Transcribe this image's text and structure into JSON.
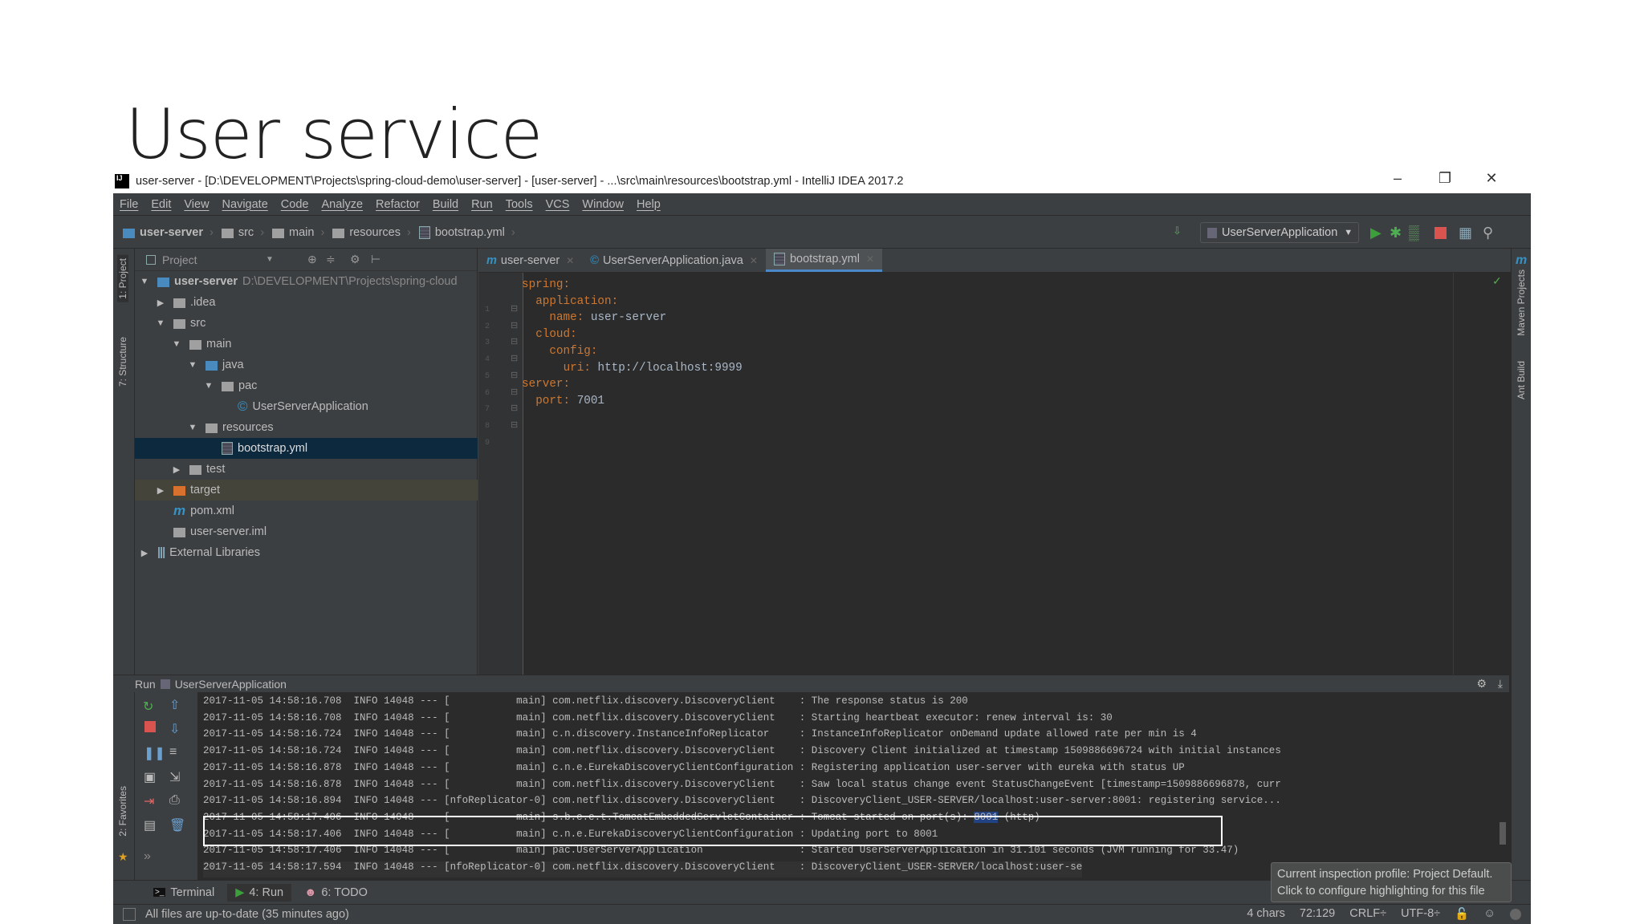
{
  "slide": {
    "title": "User service"
  },
  "window": {
    "title": "user-server - [D:\\DEVELOPMENT\\Projects\\spring-cloud-demo\\user-server] - [user-server] - ...\\src\\main\\resources\\bootstrap.yml - IntelliJ IDEA 2017.2",
    "icon": "IJ",
    "minimize": "–",
    "restore": "❐",
    "close": "✕"
  },
  "menu": [
    "File",
    "Edit",
    "View",
    "Navigate",
    "Code",
    "Analyze",
    "Refactor",
    "Build",
    "Run",
    "Tools",
    "VCS",
    "Window",
    "Help"
  ],
  "breadcrumb": [
    "user-server",
    "src",
    "main",
    "resources",
    "bootstrap.yml"
  ],
  "toolbar": {
    "run_config": "UserServerApplication"
  },
  "left_strip": {
    "project": "1: Project",
    "structure": "7: Structure",
    "favorites": "2: Favorites"
  },
  "right_strip": {
    "maven": "Maven Projects",
    "ant": "Ant Build"
  },
  "project": {
    "header": "Project",
    "tree": [
      {
        "label": "user-server",
        "path": "D:\\DEVELOPMENT\\Projects\\spring-cloud",
        "depth": 0,
        "arrow": "▼",
        "icon": "module"
      },
      {
        "label": ".idea",
        "depth": 1,
        "arrow": "▶",
        "icon": "folder"
      },
      {
        "label": "src",
        "depth": 1,
        "arrow": "▼",
        "icon": "folder"
      },
      {
        "label": "main",
        "depth": 2,
        "arrow": "▼",
        "icon": "folder"
      },
      {
        "label": "java",
        "depth": 3,
        "arrow": "▼",
        "icon": "folder-blue"
      },
      {
        "label": "pac",
        "depth": 4,
        "arrow": "▼",
        "icon": "package"
      },
      {
        "label": "UserServerApplication",
        "depth": 5,
        "arrow": "",
        "icon": "spring-class"
      },
      {
        "label": "resources",
        "depth": 3,
        "arrow": "▼",
        "icon": "folder-res"
      },
      {
        "label": "bootstrap.yml",
        "depth": 4,
        "arrow": "",
        "icon": "yml",
        "selected": true
      },
      {
        "label": "test",
        "depth": 2,
        "arrow": "▶",
        "icon": "folder"
      },
      {
        "label": "target",
        "depth": 1,
        "arrow": "▶",
        "icon": "folder-orange",
        "ignored": true
      },
      {
        "label": "pom.xml",
        "depth": 1,
        "arrow": "",
        "icon": "maven"
      },
      {
        "label": "user-server.iml",
        "depth": 1,
        "arrow": "",
        "icon": "iml"
      },
      {
        "label": "External Libraries",
        "depth": 0,
        "arrow": "▶",
        "icon": "libraries"
      }
    ]
  },
  "editor": {
    "tabs": [
      {
        "label": "user-server",
        "icon": "maven"
      },
      {
        "label": "UserServerApplication.java",
        "icon": "spring-class"
      },
      {
        "label": "bootstrap.yml",
        "icon": "yml",
        "active": true
      }
    ],
    "lines": [
      {
        "n": "1",
        "indent": 0,
        "key": "spring",
        "val": ""
      },
      {
        "n": "2",
        "indent": 1,
        "key": "application",
        "val": ""
      },
      {
        "n": "3",
        "indent": 2,
        "key": "name",
        "val": "user-server"
      },
      {
        "n": "4",
        "indent": 1,
        "key": "cloud",
        "val": ""
      },
      {
        "n": "5",
        "indent": 2,
        "key": "config",
        "val": ""
      },
      {
        "n": "6",
        "indent": 3,
        "key": "uri",
        "val": "http://localhost:9999"
      },
      {
        "n": "7",
        "indent": 0,
        "key": "server",
        "val": ""
      },
      {
        "n": "8",
        "indent": 1,
        "key": "port",
        "val": "7001"
      },
      {
        "n": "9",
        "indent": 0,
        "key": "",
        "val": ""
      }
    ]
  },
  "run": {
    "label": "Run",
    "config": "UserServerApplication",
    "log": [
      {
        "time": "2017-11-05 14:58:16.708",
        "level": "INFO",
        "pid": "14048",
        "thread": "main",
        "logger": "com.netflix.discovery.DiscoveryClient",
        "msg": "The response status is 200"
      },
      {
        "time": "2017-11-05 14:58:16.708",
        "level": "INFO",
        "pid": "14048",
        "thread": "main",
        "logger": "com.netflix.discovery.DiscoveryClient",
        "msg": "Starting heartbeat executor: renew interval is: 30"
      },
      {
        "time": "2017-11-05 14:58:16.724",
        "level": "INFO",
        "pid": "14048",
        "thread": "main",
        "logger": "c.n.discovery.InstanceInfoReplicator",
        "msg": "InstanceInfoReplicator onDemand update allowed rate per min is 4"
      },
      {
        "time": "2017-11-05 14:58:16.724",
        "level": "INFO",
        "pid": "14048",
        "thread": "main",
        "logger": "com.netflix.discovery.DiscoveryClient",
        "msg": "Discovery Client initialized at timestamp 1509886696724 with initial instances"
      },
      {
        "time": "2017-11-05 14:58:16.878",
        "level": "INFO",
        "pid": "14048",
        "thread": "main",
        "logger": "c.n.e.EurekaDiscoveryClientConfiguration",
        "msg": "Registering application user-server with eureka with status UP"
      },
      {
        "time": "2017-11-05 14:58:16.878",
        "level": "INFO",
        "pid": "14048",
        "thread": "main",
        "logger": "com.netflix.discovery.DiscoveryClient",
        "msg": "Saw local status change event StatusChangeEvent [timestamp=1509886696878, curr"
      },
      {
        "time": "2017-11-05 14:58:16.894",
        "level": "INFO",
        "pid": "14048",
        "thread": "nfoReplicator-0",
        "logger": "com.netflix.discovery.DiscoveryClient",
        "msg": "DiscoveryClient_USER-SERVER/localhost:user-server:8001: registering service..."
      },
      {
        "time": "2017-11-05 14:58:17.406",
        "level": "INFO",
        "pid": "14048",
        "thread": "main",
        "logger": "s.b.c.e.t.TomcatEmbeddedServletContainer",
        "msg": "Tomcat started on port(s): ",
        "hl": "8001",
        "after": " (http)"
      },
      {
        "time": "2017-11-05 14:58:17.406",
        "level": "INFO",
        "pid": "14048",
        "thread": "main",
        "logger": "c.n.e.EurekaDiscoveryClientConfiguration",
        "msg": "Updating port to 8001"
      },
      {
        "time": "2017-11-05 14:58:17.406",
        "level": "INFO",
        "pid": "14048",
        "thread": "main",
        "logger": "pac.UserServerApplication",
        "msg": "Started UserServerApplication in 31.101 seconds (JVM running for 33.47)"
      },
      {
        "time": "2017-11-05 14:58:17.594",
        "level": "INFO",
        "pid": "14048",
        "thread": "nfoReplicator-0",
        "logger": "com.netflix.discovery.DiscoveryClient",
        "msg": "DiscoveryClient_USER-SERVER/localhost:user-se"
      }
    ]
  },
  "bottom_tabs": [
    {
      "label": "Terminal"
    },
    {
      "label": "4: Run",
      "active": true
    },
    {
      "label": "6: TODO"
    }
  ],
  "status": {
    "message": "All files are up-to-date (35 minutes ago)",
    "chars": "4 chars",
    "position": "72:129",
    "line_sep": "CRLF÷",
    "encoding": "UTF-8÷"
  },
  "tooltip": {
    "line1": "Current inspection profile: Project Default.",
    "line2": "Click to configure highlighting for this file"
  },
  "colors": {
    "editor_bg": "#2b2b2b",
    "panel_bg": "#3c3f41",
    "yaml_key": "#cc7832",
    "selection": "#0d293e",
    "accent": "#4a88c7"
  }
}
